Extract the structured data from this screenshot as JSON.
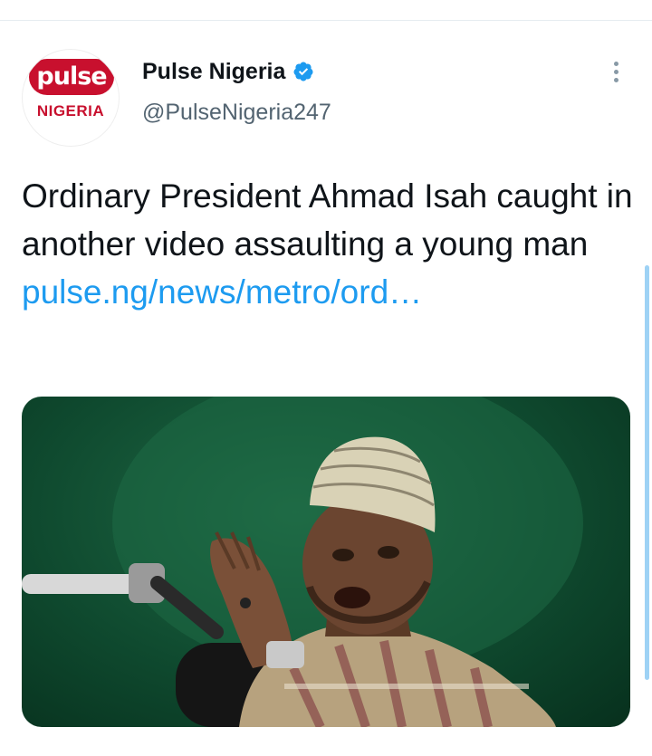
{
  "tweet": {
    "author": {
      "display_name": "Pulse Nigeria",
      "handle": "@PulseNigeria247",
      "avatar_logo_text": "pulse",
      "avatar_logo_subtext": "NIGERIA",
      "verified": true
    },
    "text": "Ordinary President Ahmad Isah caught in another video assaulting a young man ",
    "link_text": "pulse.ng/news/​metro/ord…",
    "media": {
      "icon": "photo"
    }
  },
  "colors": {
    "brand_red": "#c8102e",
    "link_blue": "#1d9bf0",
    "verified_blue": "#1d9bf0",
    "text_dark": "#0f1419",
    "text_gray": "#536471"
  },
  "icons": {
    "verified": "verified-badge-icon",
    "more": "more-options-icon"
  }
}
